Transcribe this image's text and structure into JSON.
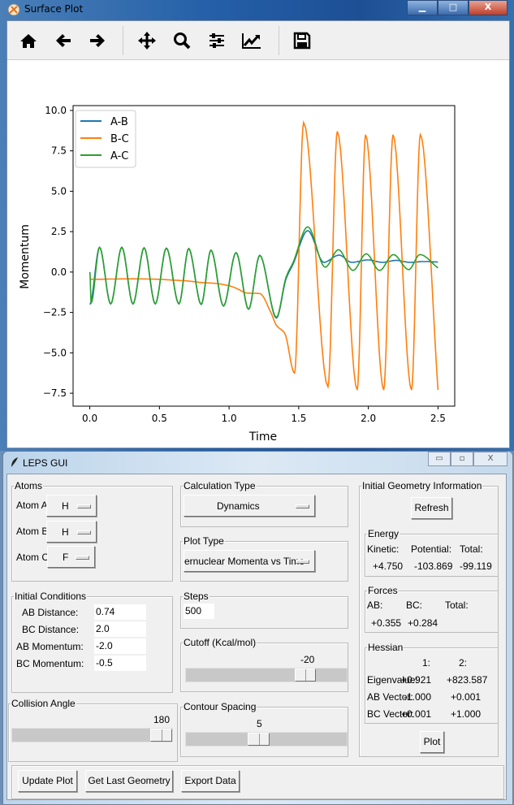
{
  "plot_window": {
    "title": "Surface Plot",
    "controls": {
      "minimize": "▁",
      "maximize": "□",
      "close": "X"
    },
    "toolbar": [
      "home-icon",
      "back-icon",
      "forward-icon",
      "pan-icon",
      "zoom-icon",
      "configure-subplots-icon",
      "edit-axis-icon",
      "save-icon"
    ]
  },
  "chart_data": {
    "type": "line",
    "title": "",
    "xlabel": "Time",
    "ylabel": "Momentum",
    "xlim": [
      -0.12,
      2.62
    ],
    "ylim": [
      -8.3,
      10.3
    ],
    "xticks": [
      0.0,
      0.5,
      1.0,
      1.5,
      2.0,
      2.5
    ],
    "xtick_labels": [
      "0.0",
      "0.5",
      "1.0",
      "1.5",
      "2.0",
      "2.5"
    ],
    "yticks": [
      -7.5,
      -5.0,
      -2.5,
      0.0,
      2.5,
      5.0,
      7.5,
      10.0
    ],
    "ytick_labels": [
      "−7.5",
      "−5.0",
      "−2.5",
      "0.0",
      "2.5",
      "5.0",
      "7.5",
      "10.0"
    ],
    "grid": false,
    "legend_position": "top-left",
    "series": [
      {
        "name": "A-B",
        "color": "#1f77b4",
        "points": [
          [
            0,
            -2.0
          ],
          [
            0.07,
            1.53
          ],
          [
            0.15,
            -1.97
          ],
          [
            0.23,
            1.53
          ],
          [
            0.31,
            -1.97
          ],
          [
            0.39,
            1.5
          ],
          [
            0.47,
            -1.97
          ],
          [
            0.55,
            1.48
          ],
          [
            0.64,
            -1.97
          ],
          [
            0.71,
            1.45
          ],
          [
            0.8,
            -2.0
          ],
          [
            0.87,
            1.35
          ],
          [
            0.96,
            -2.1
          ],
          [
            1.05,
            1.2
          ],
          [
            1.14,
            -2.3
          ],
          [
            1.22,
            1.03
          ],
          [
            1.34,
            -2.85
          ],
          [
            1.41,
            -0.4
          ],
          [
            1.46,
            0.5
          ],
          [
            1.565,
            2.56
          ],
          [
            1.68,
            0.6
          ],
          [
            1.79,
            1.05
          ],
          [
            1.88,
            0.6
          ],
          [
            2.0,
            0.75
          ],
          [
            2.1,
            0.6
          ],
          [
            2.2,
            0.72
          ],
          [
            2.3,
            0.6
          ],
          [
            2.4,
            0.65
          ],
          [
            2.5,
            0.62
          ]
        ]
      },
      {
        "name": "B-C",
        "color": "#ff7f0e",
        "points": [
          [
            0,
            -0.45
          ],
          [
            0.3,
            -0.42
          ],
          [
            0.5,
            -0.45
          ],
          [
            0.6,
            -0.5
          ],
          [
            0.7,
            -0.55
          ],
          [
            0.8,
            -0.65
          ],
          [
            0.9,
            -0.7
          ],
          [
            1.0,
            -0.85
          ],
          [
            1.05,
            -1.0
          ],
          [
            1.13,
            -1.3
          ],
          [
            1.22,
            -1.33
          ],
          [
            1.3,
            -2.5
          ],
          [
            1.34,
            -3.3
          ],
          [
            1.4,
            -3.8
          ],
          [
            1.47,
            -6.25
          ],
          [
            1.535,
            9.25
          ],
          [
            1.71,
            -7.1
          ],
          [
            1.777,
            8.7
          ],
          [
            1.92,
            -7.3
          ],
          [
            1.98,
            8.5
          ],
          [
            2.11,
            -7.3
          ],
          [
            2.177,
            8.5
          ],
          [
            2.31,
            -7.3
          ],
          [
            2.373,
            8.5
          ],
          [
            2.5,
            -7.3
          ]
        ]
      },
      {
        "name": "A-C",
        "color": "#2ca02c",
        "points": [
          [
            0,
            0.0
          ],
          [
            0.01,
            -1.9
          ],
          [
            0.07,
            1.53
          ],
          [
            0.15,
            -1.97
          ],
          [
            0.23,
            1.53
          ],
          [
            0.31,
            -1.97
          ],
          [
            0.39,
            1.5
          ],
          [
            0.47,
            -1.97
          ],
          [
            0.55,
            1.48
          ],
          [
            0.64,
            -1.97
          ],
          [
            0.71,
            1.45
          ],
          [
            0.8,
            -2.0
          ],
          [
            0.87,
            1.35
          ],
          [
            0.96,
            -2.1
          ],
          [
            1.05,
            1.2
          ],
          [
            1.14,
            -2.3
          ],
          [
            1.22,
            1.03
          ],
          [
            1.34,
            -2.8
          ],
          [
            1.41,
            -0.3
          ],
          [
            1.46,
            0.6
          ],
          [
            1.565,
            2.8
          ],
          [
            1.69,
            0.3
          ],
          [
            1.785,
            1.38
          ],
          [
            1.89,
            0.1
          ],
          [
            1.985,
            1.13
          ],
          [
            2.08,
            0.1
          ],
          [
            2.18,
            1.08
          ],
          [
            2.29,
            0.15
          ],
          [
            2.37,
            1.08
          ],
          [
            2.5,
            0.25
          ]
        ]
      }
    ]
  },
  "gui": {
    "title": "LEPS GUI",
    "controls": {
      "minimize": "▭",
      "maximize": "▫",
      "close": "X"
    },
    "atoms": {
      "title": "Atoms",
      "a_label": "Atom A:",
      "a_value": "H",
      "b_label": "Atom B:",
      "b_value": "H",
      "c_label": "Atom C:",
      "c_value": "F"
    },
    "calc": {
      "title": "Calculation Type",
      "value": "Dynamics"
    },
    "plot_type": {
      "title": "Plot Type",
      "value": "ernuclear Momenta vs Time"
    },
    "initial": {
      "title": "Initial Conditions",
      "ab_dist_label": "AB Distance:",
      "ab_dist": "0.74",
      "bc_dist_label": "BC Distance:",
      "bc_dist": "2.0",
      "ab_mom_label": "AB Momentum:",
      "ab_mom": "-2.0",
      "bc_mom_label": "BC Momentum:",
      "bc_mom": "-0.5"
    },
    "steps": {
      "title": "Steps",
      "value": "500"
    },
    "cutoff": {
      "title": "Cutoff (Kcal/mol)",
      "value": "-20"
    },
    "collision": {
      "title": "Collision Angle",
      "value": "180"
    },
    "contour": {
      "title": "Contour Spacing",
      "value": "5"
    },
    "geom": {
      "title": "Initial Geometry Information",
      "refresh": "Refresh",
      "energy": {
        "title": "Energy",
        "kinetic_label": "Kinetic:",
        "potential_label": "Potential:",
        "total_label": "Total:",
        "kinetic": "+4.750",
        "potential": "-103.869",
        "total": "-99.119"
      },
      "forces": {
        "title": "Forces",
        "ab_label": "AB:",
        "bc_label": "BC:",
        "total_label": "Total:",
        "ab": "+0.355",
        "bc": "+0.284"
      },
      "hessian": {
        "title": "Hessian",
        "col1": "1:",
        "col2": "2:",
        "eig_label": "Eigenvalue:",
        "eig1": "+0.921",
        "eig2": "+823.587",
        "abv_label": "AB Vector:",
        "abv1": "-1.000",
        "abv2": "+0.001",
        "bcv_label": "BC Vector:",
        "bcv1": "+0.001",
        "bcv2": "+1.000"
      },
      "plot": "Plot"
    },
    "buttons": {
      "update": "Update Plot",
      "last_geom": "Get Last Geometry",
      "export": "Export Data"
    }
  }
}
